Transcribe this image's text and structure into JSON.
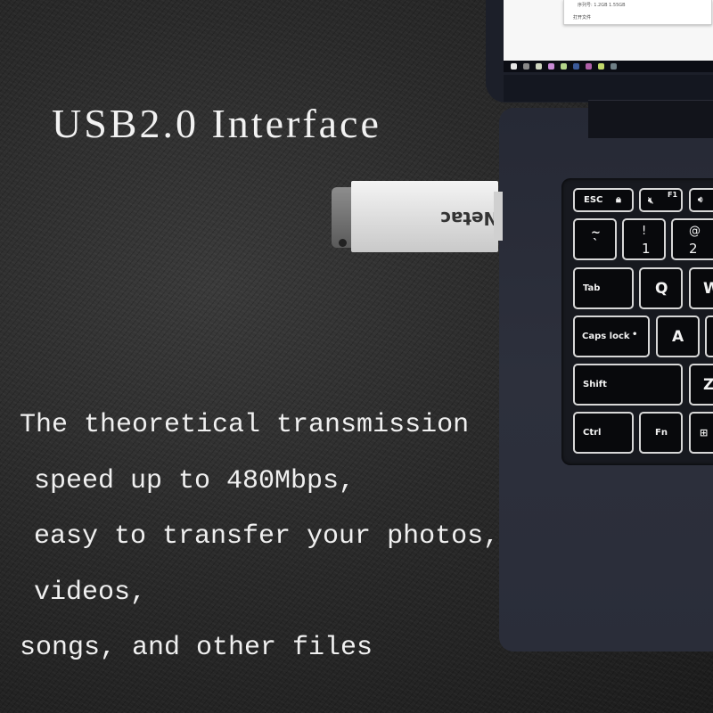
{
  "headline": "USB2.0 Interface",
  "description_lines": [
    "The theoretical transmission",
    "speed up to 480Mbps,",
    "easy to transfer your photos,",
    "videos,",
    "songs, and other files"
  ],
  "usb_drive": {
    "brand": "Netac"
  },
  "screen": {
    "dialog_line": "序列号: 1.2GB  1.55GB",
    "dialog_button": "打开文件"
  },
  "taskbar_icons": [
    {
      "name": "start-icon",
      "color": "#e6e6e6"
    },
    {
      "name": "search-icon",
      "color": "#888888"
    },
    {
      "name": "folder-icon",
      "color": "#cfd6c0"
    },
    {
      "name": "chrome-icon",
      "color": "#c98bd6"
    },
    {
      "name": "wechat-icon",
      "color": "#b3d48a"
    },
    {
      "name": "ps-icon",
      "color": "#3b5a9a"
    },
    {
      "name": "app-icon",
      "color": "#b060a8"
    },
    {
      "name": "ie-icon",
      "color": "#c2d86a"
    },
    {
      "name": "mail-icon",
      "color": "#6f7f86"
    }
  ],
  "keyboard": {
    "esc": "ESC",
    "f1": "F1",
    "tilde_top": "~",
    "tilde_bottom": "`",
    "one_top": "!",
    "one_bottom": "1",
    "two_top": "@",
    "two_bottom": "2",
    "tab": "Tab",
    "q": "Q",
    "w": "W",
    "caps": "Caps lock",
    "a": "A",
    "shift": "Shift",
    "z": "Z",
    "ctrl": "Ctrl",
    "fn": "Fn"
  }
}
